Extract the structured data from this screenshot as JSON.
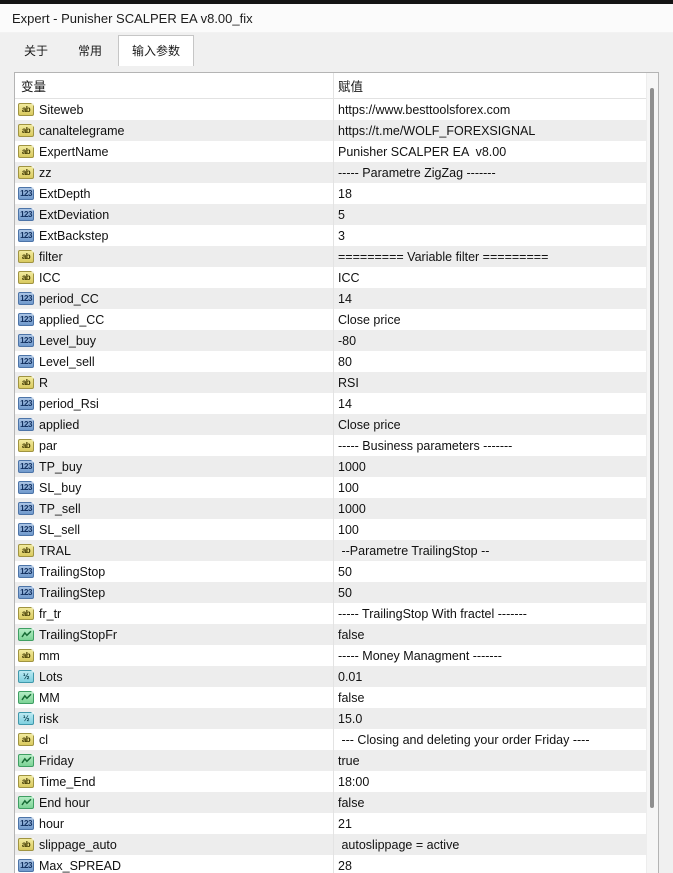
{
  "window": {
    "title": "Expert - Punisher SCALPER EA v8.00_fix"
  },
  "tabs": [
    {
      "label": "关于",
      "active": false
    },
    {
      "label": "常用",
      "active": false
    },
    {
      "label": "输入参数",
      "active": true
    }
  ],
  "table": {
    "columns": [
      "变量",
      "赋值"
    ],
    "rows": [
      {
        "name": "Siteweb",
        "type": "string",
        "value": "https://www.besttoolsforex.com"
      },
      {
        "name": "canaltelegrame",
        "type": "string",
        "value": "https://t.me/WOLF_FOREXSIGNAL"
      },
      {
        "name": "ExpertName",
        "type": "string",
        "value": "Punisher SCALPER EA  v8.00"
      },
      {
        "name": "zz",
        "type": "string",
        "value": "----- Parametre ZigZag -------"
      },
      {
        "name": "ExtDepth",
        "type": "integer",
        "value": "18"
      },
      {
        "name": "ExtDeviation",
        "type": "integer",
        "value": "5"
      },
      {
        "name": "ExtBackstep",
        "type": "integer",
        "value": "3"
      },
      {
        "name": "filter",
        "type": "string",
        "value": "========= Variable filter ========="
      },
      {
        "name": "ICC",
        "type": "string",
        "value": "ICC"
      },
      {
        "name": "period_CC",
        "type": "integer",
        "value": "14"
      },
      {
        "name": "applied_CC",
        "type": "integer",
        "value": "Close price"
      },
      {
        "name": "Level_buy",
        "type": "integer",
        "value": "-80"
      },
      {
        "name": "Level_sell",
        "type": "integer",
        "value": "80"
      },
      {
        "name": "R",
        "type": "string",
        "value": "RSI"
      },
      {
        "name": "period_Rsi",
        "type": "integer",
        "value": "14"
      },
      {
        "name": "applied",
        "type": "integer",
        "value": "Close price"
      },
      {
        "name": "par",
        "type": "string",
        "value": "----- Business parameters -------"
      },
      {
        "name": "TP_buy",
        "type": "integer",
        "value": "1000"
      },
      {
        "name": "SL_buy",
        "type": "integer",
        "value": "100"
      },
      {
        "name": "TP_sell",
        "type": "integer",
        "value": "1000"
      },
      {
        "name": "SL_sell",
        "type": "integer",
        "value": "100"
      },
      {
        "name": "TRAL",
        "type": "string",
        "value": " --Parametre TrailingStop --"
      },
      {
        "name": "TrailingStop",
        "type": "integer",
        "value": "50"
      },
      {
        "name": "TrailingStep",
        "type": "integer",
        "value": "50"
      },
      {
        "name": "fr_tr",
        "type": "string",
        "value": "----- TrailingStop With fractel -------"
      },
      {
        "name": "TrailingStopFr",
        "type": "boolean",
        "value": "false"
      },
      {
        "name": "mm",
        "type": "string",
        "value": "----- Money Managment -------"
      },
      {
        "name": "Lots",
        "type": "double",
        "value": "0.01"
      },
      {
        "name": "MM",
        "type": "boolean",
        "value": "false"
      },
      {
        "name": "risk",
        "type": "double",
        "value": "15.0"
      },
      {
        "name": "cl",
        "type": "string",
        "value": " --- Closing and deleting your order Friday ----"
      },
      {
        "name": "Friday",
        "type": "boolean",
        "value": "true"
      },
      {
        "name": "Time_End",
        "type": "string",
        "value": "18:00"
      },
      {
        "name": "End hour",
        "type": "boolean",
        "value": "false"
      },
      {
        "name": "hour",
        "type": "integer",
        "value": "21"
      },
      {
        "name": "slippage_auto",
        "type": "string",
        "value": " autoslippage = active"
      },
      {
        "name": "Max_SPREAD",
        "type": "integer",
        "value": "28"
      }
    ]
  },
  "icons": {
    "string": {
      "glyph": "ab",
      "bg_light": "#f2ea9e",
      "bg": "#d9c95f",
      "border": "#a09441",
      "color": "#3f3800"
    },
    "integer": {
      "glyph": "123",
      "bg_light": "#aac4e4",
      "bg": "#7099cc",
      "border": "#4c74a8",
      "color": "#12305f"
    },
    "double": {
      "glyph": "½",
      "bg_light": "#bce9f2",
      "bg": "#7fd0df",
      "border": "#3f98ab",
      "color": "#073f4d"
    },
    "boolean": {
      "glyph": "zigzag",
      "bg_light": "#b4ecc4",
      "bg": "#7cd396",
      "border": "#3f9f63",
      "color": "#166a34"
    }
  },
  "colors": {
    "row_alt": "#ededed",
    "table_border": "#b4b4b4",
    "scroll_thumb": "#8f8f8f"
  }
}
